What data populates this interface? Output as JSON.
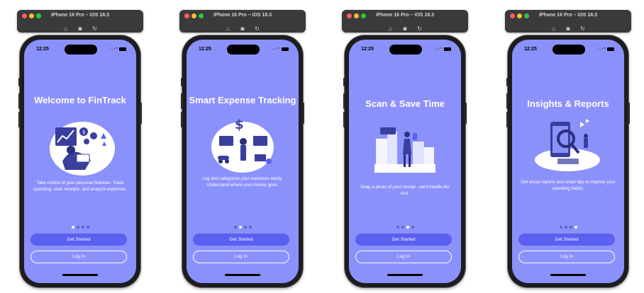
{
  "simulator": {
    "title": "iPhone 16 Pro – iOS 18.3",
    "icons": [
      "home-icon",
      "screenshot-icon",
      "rotate-icon"
    ]
  },
  "status_bar": {
    "time": "12:25"
  },
  "colors": {
    "screen_bg": "#8b91fa",
    "primary_button": "#5a60f0",
    "illustration_dark": "#3a3f9e",
    "illustration_light": "#ffffff"
  },
  "buttons": {
    "get_started": "Get Started",
    "log_in": "Log In"
  },
  "pages": [
    {
      "title": "Welcome to FinTrack",
      "description": "Take control of your personal finances. Track spending, scan receipts, and analyze expenses.",
      "active_index": 0
    },
    {
      "title": "Smart Expense Tracking",
      "description": "Log and categorize your expenses easily. Understand where your money goes.",
      "active_index": 1
    },
    {
      "title": "Scan & Save Time",
      "description": "Snap a photo of your receipt - we'll handle the rest.",
      "active_index": 2
    },
    {
      "title": "Insights & Reports",
      "description": "Get visual reports and smart tips to improve your spending habits.",
      "active_index": 3
    }
  ]
}
